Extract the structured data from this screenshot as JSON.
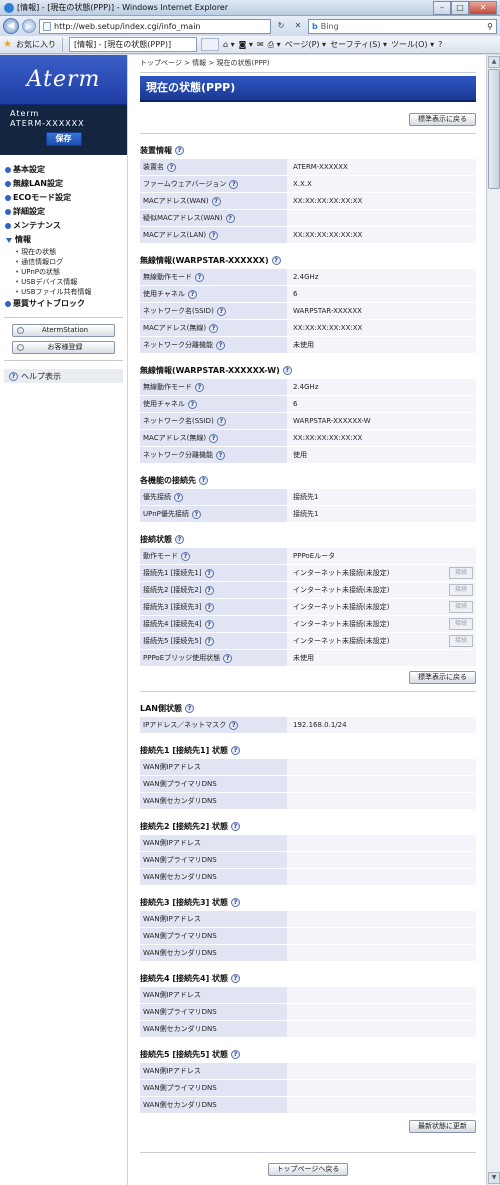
{
  "window": {
    "title": "[情報] - [現在の状態(PPP)] - Windows Internet Explorer",
    "minimize": "–",
    "maximize": "□",
    "close": "✕"
  },
  "address": {
    "url": "http://web.setup/index.cgi/info_main",
    "search_placeholder": "Bing",
    "back": "◀",
    "forward": "▶",
    "refresh": "↻",
    "stop": "✕"
  },
  "favorites": {
    "label": "お気に入り",
    "tab_label": "[情報] - [現在の状態(PPP)]",
    "commands": [
      "ページ(P) ▾",
      "セーフティ(S) ▾",
      "ツール(O) ▾",
      "?"
    ]
  },
  "sidebar": {
    "logo": "Aterm",
    "device_line1": "Aterm",
    "device_line2": "ATERM-XXXXXX",
    "save_label": "保存",
    "menu": [
      {
        "label": "基本設定"
      },
      {
        "label": "無線LAN設定"
      },
      {
        "label": "ECOモード設定"
      },
      {
        "label": "詳細設定"
      },
      {
        "label": "メンテナンス"
      }
    ],
    "info_label": "情報",
    "info_sub": [
      "現在の状態",
      "通信情報ログ",
      "UPnPの状態",
      "USBデバイス情報",
      "USBファイル共有情報"
    ],
    "malicious_label": "悪質サイトブロック",
    "aterm_station_label": "AtermStation",
    "customer_reg_label": "お客様登録",
    "help_label": "ヘルプ表示"
  },
  "main": {
    "breadcrumb": "トップページ > 情報 > 現在の状態(PPP)",
    "title": "現在の状態(PPP)",
    "standard_view_label": "標準表示に戻る",
    "refresh_label": "最新状態に更新",
    "top_page_label": "トップページへ戻る",
    "connect_label": "接続",
    "device": {
      "head": "装置情報",
      "rows": [
        {
          "k": "装置名",
          "v": "ATERM-XXXXXX"
        },
        {
          "k": "ファームウェアバージョン",
          "v": "X.X.X"
        },
        {
          "k": "MACアドレス(WAN)",
          "v": "XX:XX:XX:XX:XX:XX"
        },
        {
          "k": "疑似MACアドレス(WAN)",
          "v": ""
        },
        {
          "k": "MACアドレス(LAN)",
          "v": "XX:XX:XX:XX:XX:XX"
        }
      ]
    },
    "wireless1": {
      "head": "無線情報(WARPSTAR-XXXXXX)",
      "rows": [
        {
          "k": "無線動作モード",
          "v": "2.4GHz"
        },
        {
          "k": "使用チャネル",
          "v": "6"
        },
        {
          "k": "ネットワーク名(SSID)",
          "v": "WARPSTAR-XXXXXX"
        },
        {
          "k": "MACアドレス(無線)",
          "v": "XX:XX:XX:XX:XX:XX"
        },
        {
          "k": "ネットワーク分離機能",
          "v": "未使用"
        }
      ]
    },
    "wireless2": {
      "head": "無線情報(WARPSTAR-XXXXXX-W)",
      "rows": [
        {
          "k": "無線動作モード",
          "v": "2.4GHz"
        },
        {
          "k": "使用チャネル",
          "v": "6"
        },
        {
          "k": "ネットワーク名(SSID)",
          "v": "WARPSTAR-XXXXXX-W"
        },
        {
          "k": "MACアドレス(無線)",
          "v": "XX:XX:XX:XX:XX:XX"
        },
        {
          "k": "ネットワーク分離機能",
          "v": "使用"
        }
      ]
    },
    "function_conn": {
      "head": "各機能の接続先",
      "rows": [
        {
          "k": "優先接続",
          "v": "接続先1"
        },
        {
          "k": "UPnP優先接続",
          "v": "接続先1"
        }
      ]
    },
    "conn_status": {
      "head": "接続状態",
      "mode": {
        "k": "動作モード",
        "v": "PPPoEルータ"
      },
      "rows": [
        {
          "k": "接続先1 [接続先1]",
          "v": "インターネット未接続(未設定)"
        },
        {
          "k": "接続先2 [接続先2]",
          "v": "インターネット未接続(未設定)"
        },
        {
          "k": "接続先3 [接続先3]",
          "v": "インターネット未接続(未設定)"
        },
        {
          "k": "接続先4 [接続先4]",
          "v": "インターネット未接続(未設定)"
        },
        {
          "k": "接続先5 [接続先5]",
          "v": "インターネット未接続(未設定)"
        }
      ],
      "bridge": {
        "k": "PPPoEブリッジ使用状態",
        "v": "未使用"
      }
    },
    "lan": {
      "head": "LAN側状態",
      "rows": [
        {
          "k": "IPアドレス／ネットマスク",
          "v": "192.168.0.1/24"
        }
      ]
    },
    "wan_sections": [
      {
        "head": "接続先1 [接続先1] 状態",
        "rows": [
          {
            "k": "WAN側IPアドレス",
            "v": ""
          },
          {
            "k": "WAN側プライマリDNS",
            "v": ""
          },
          {
            "k": "WAN側セカンダリDNS",
            "v": ""
          }
        ]
      },
      {
        "head": "接続先2 [接続先2] 状態",
        "rows": [
          {
            "k": "WAN側IPアドレス",
            "v": ""
          },
          {
            "k": "WAN側プライマリDNS",
            "v": ""
          },
          {
            "k": "WAN側セカンダリDNS",
            "v": ""
          }
        ]
      },
      {
        "head": "接続先3 [接続先3] 状態",
        "rows": [
          {
            "k": "WAN側IPアドレス",
            "v": ""
          },
          {
            "k": "WAN側プライマリDNS",
            "v": ""
          },
          {
            "k": "WAN側セカンダリDNS",
            "v": ""
          }
        ]
      },
      {
        "head": "接続先4 [接続先4] 状態",
        "rows": [
          {
            "k": "WAN側IPアドレス",
            "v": ""
          },
          {
            "k": "WAN側プライマリDNS",
            "v": ""
          },
          {
            "k": "WAN側セカンダリDNS",
            "v": ""
          }
        ]
      },
      {
        "head": "接続先5 [接続先5] 状態",
        "rows": [
          {
            "k": "WAN側IPアドレス",
            "v": ""
          },
          {
            "k": "WAN側プライマリDNS",
            "v": ""
          },
          {
            "k": "WAN側セカンダリDNS",
            "v": ""
          }
        ]
      }
    ]
  }
}
